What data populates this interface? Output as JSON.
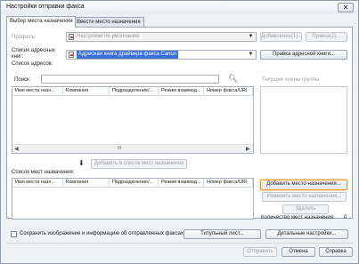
{
  "window": {
    "title": "Настройки отправки факса",
    "close_glyph": "✕"
  },
  "tabs": [
    {
      "label": "Выбор места назначения",
      "active": true
    },
    {
      "label": "Ввести место назначения",
      "active": false
    }
  ],
  "profile": {
    "label": "Профиль:",
    "value": "Настройки по умолчанию",
    "add_button": "Добавление(1)...",
    "edit_button": "Правка(2)..."
  },
  "address_book": {
    "label": "Список адресных книг:",
    "value": "Адресная книга драйвера факса Canon",
    "edit_button": "Правка адресной книги..."
  },
  "address_list": {
    "label": "Список адресов:",
    "search_label": "Поиск:",
    "search_value": "",
    "columns": [
      "Имя места назн...",
      "Компания",
      "Подразделение/...",
      "Режим взаимод...",
      "Номер факса/URI"
    ],
    "scroll_label": "III"
  },
  "group_members_label": "Текущие члены группы",
  "add_to_destination_button": "Добавить в список мест назначения",
  "destination_list": {
    "label": "Список мест назначения:",
    "columns": [
      "Имя места назн...",
      "Компания",
      "Подразделение/...",
      "Режим взаимод...",
      "Номер факса/URI"
    ]
  },
  "side_buttons": {
    "add_destination": "Добавить место назначения...",
    "edit_destination": "Изменить место назначения...",
    "delete": "Удалить"
  },
  "destination_count": {
    "label": "Количество мест назначения:",
    "value": "0"
  },
  "save_image_checkbox": {
    "label": "Сохранить изображение и информацию об отправленных факсах",
    "checked": false
  },
  "bottom_buttons": {
    "cover_sheet": "Титульный лист...",
    "details": "Детальные настройки..."
  },
  "footer_buttons": {
    "send": "Отправить",
    "cancel": "Отмена",
    "help": "Справка"
  },
  "colors": {
    "highlight": "#e7a23b",
    "accent_red": "#cc2222"
  }
}
